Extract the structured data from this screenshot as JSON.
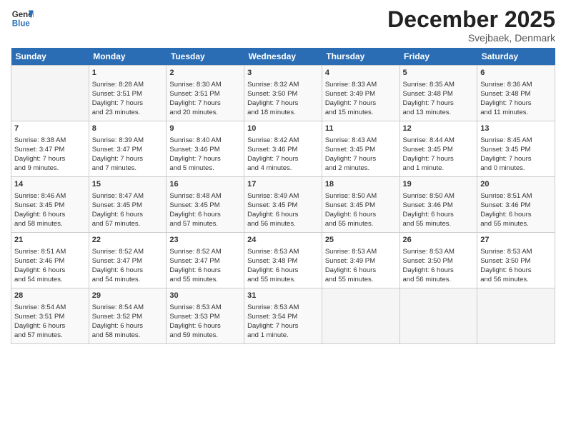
{
  "header": {
    "logo_line1": "General",
    "logo_line2": "Blue",
    "title": "December 2025",
    "location": "Svejbaek, Denmark"
  },
  "columns": [
    "Sunday",
    "Monday",
    "Tuesday",
    "Wednesday",
    "Thursday",
    "Friday",
    "Saturday"
  ],
  "weeks": [
    [
      {
        "day": "",
        "content": ""
      },
      {
        "day": "1",
        "content": "Sunrise: 8:28 AM\nSunset: 3:51 PM\nDaylight: 7 hours\nand 23 minutes."
      },
      {
        "day": "2",
        "content": "Sunrise: 8:30 AM\nSunset: 3:51 PM\nDaylight: 7 hours\nand 20 minutes."
      },
      {
        "day": "3",
        "content": "Sunrise: 8:32 AM\nSunset: 3:50 PM\nDaylight: 7 hours\nand 18 minutes."
      },
      {
        "day": "4",
        "content": "Sunrise: 8:33 AM\nSunset: 3:49 PM\nDaylight: 7 hours\nand 15 minutes."
      },
      {
        "day": "5",
        "content": "Sunrise: 8:35 AM\nSunset: 3:48 PM\nDaylight: 7 hours\nand 13 minutes."
      },
      {
        "day": "6",
        "content": "Sunrise: 8:36 AM\nSunset: 3:48 PM\nDaylight: 7 hours\nand 11 minutes."
      }
    ],
    [
      {
        "day": "7",
        "content": "Sunrise: 8:38 AM\nSunset: 3:47 PM\nDaylight: 7 hours\nand 9 minutes."
      },
      {
        "day": "8",
        "content": "Sunrise: 8:39 AM\nSunset: 3:47 PM\nDaylight: 7 hours\nand 7 minutes."
      },
      {
        "day": "9",
        "content": "Sunrise: 8:40 AM\nSunset: 3:46 PM\nDaylight: 7 hours\nand 5 minutes."
      },
      {
        "day": "10",
        "content": "Sunrise: 8:42 AM\nSunset: 3:46 PM\nDaylight: 7 hours\nand 4 minutes."
      },
      {
        "day": "11",
        "content": "Sunrise: 8:43 AM\nSunset: 3:45 PM\nDaylight: 7 hours\nand 2 minutes."
      },
      {
        "day": "12",
        "content": "Sunrise: 8:44 AM\nSunset: 3:45 PM\nDaylight: 7 hours\nand 1 minute."
      },
      {
        "day": "13",
        "content": "Sunrise: 8:45 AM\nSunset: 3:45 PM\nDaylight: 7 hours\nand 0 minutes."
      }
    ],
    [
      {
        "day": "14",
        "content": "Sunrise: 8:46 AM\nSunset: 3:45 PM\nDaylight: 6 hours\nand 58 minutes."
      },
      {
        "day": "15",
        "content": "Sunrise: 8:47 AM\nSunset: 3:45 PM\nDaylight: 6 hours\nand 57 minutes."
      },
      {
        "day": "16",
        "content": "Sunrise: 8:48 AM\nSunset: 3:45 PM\nDaylight: 6 hours\nand 57 minutes."
      },
      {
        "day": "17",
        "content": "Sunrise: 8:49 AM\nSunset: 3:45 PM\nDaylight: 6 hours\nand 56 minutes."
      },
      {
        "day": "18",
        "content": "Sunrise: 8:50 AM\nSunset: 3:45 PM\nDaylight: 6 hours\nand 55 minutes."
      },
      {
        "day": "19",
        "content": "Sunrise: 8:50 AM\nSunset: 3:46 PM\nDaylight: 6 hours\nand 55 minutes."
      },
      {
        "day": "20",
        "content": "Sunrise: 8:51 AM\nSunset: 3:46 PM\nDaylight: 6 hours\nand 55 minutes."
      }
    ],
    [
      {
        "day": "21",
        "content": "Sunrise: 8:51 AM\nSunset: 3:46 PM\nDaylight: 6 hours\nand 54 minutes."
      },
      {
        "day": "22",
        "content": "Sunrise: 8:52 AM\nSunset: 3:47 PM\nDaylight: 6 hours\nand 54 minutes."
      },
      {
        "day": "23",
        "content": "Sunrise: 8:52 AM\nSunset: 3:47 PM\nDaylight: 6 hours\nand 55 minutes."
      },
      {
        "day": "24",
        "content": "Sunrise: 8:53 AM\nSunset: 3:48 PM\nDaylight: 6 hours\nand 55 minutes."
      },
      {
        "day": "25",
        "content": "Sunrise: 8:53 AM\nSunset: 3:49 PM\nDaylight: 6 hours\nand 55 minutes."
      },
      {
        "day": "26",
        "content": "Sunrise: 8:53 AM\nSunset: 3:50 PM\nDaylight: 6 hours\nand 56 minutes."
      },
      {
        "day": "27",
        "content": "Sunrise: 8:53 AM\nSunset: 3:50 PM\nDaylight: 6 hours\nand 56 minutes."
      }
    ],
    [
      {
        "day": "28",
        "content": "Sunrise: 8:54 AM\nSunset: 3:51 PM\nDaylight: 6 hours\nand 57 minutes."
      },
      {
        "day": "29",
        "content": "Sunrise: 8:54 AM\nSunset: 3:52 PM\nDaylight: 6 hours\nand 58 minutes."
      },
      {
        "day": "30",
        "content": "Sunrise: 8:53 AM\nSunset: 3:53 PM\nDaylight: 6 hours\nand 59 minutes."
      },
      {
        "day": "31",
        "content": "Sunrise: 8:53 AM\nSunset: 3:54 PM\nDaylight: 7 hours\nand 1 minute."
      },
      {
        "day": "",
        "content": ""
      },
      {
        "day": "",
        "content": ""
      },
      {
        "day": "",
        "content": ""
      }
    ]
  ]
}
